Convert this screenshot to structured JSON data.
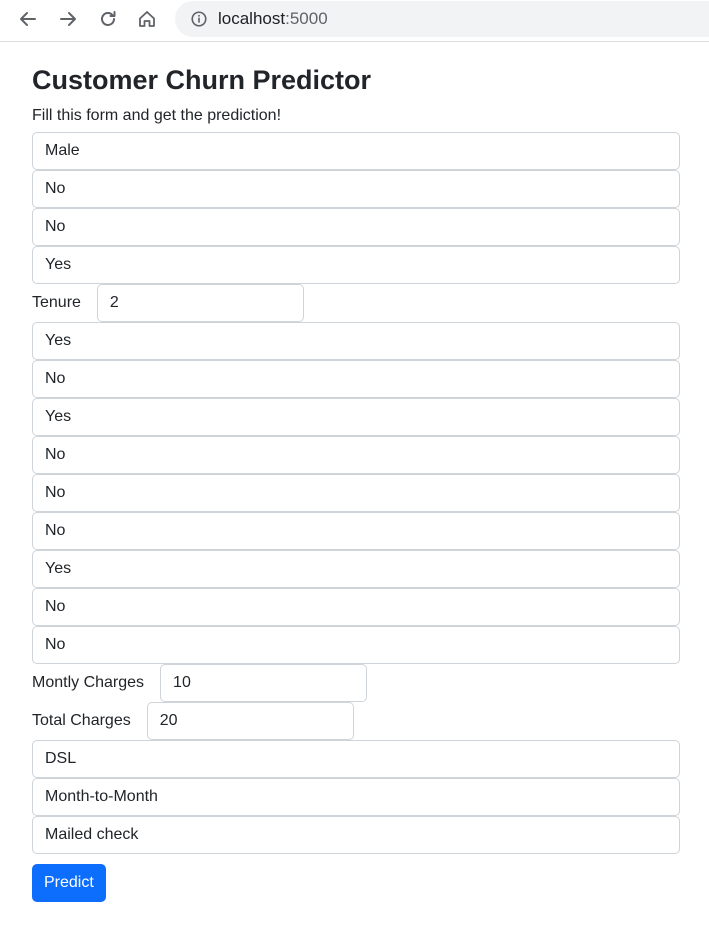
{
  "browser": {
    "url_host": "localhost",
    "url_port": ":5000"
  },
  "page": {
    "title": "Customer Churn Predictor",
    "subtitle": "Fill this form and get the prediction!"
  },
  "form": {
    "gender": "Male",
    "senior_citizen": "No",
    "partner": "No",
    "dependents": "Yes",
    "tenure_label": "Tenure",
    "tenure_value": "2",
    "phone_service": "Yes",
    "multiple_lines": "No",
    "online_security": "Yes",
    "online_backup": "No",
    "device_protection": "No",
    "tech_support": "No",
    "streaming_tv": "Yes",
    "streaming_movies": "No",
    "paperless_billing": "No",
    "monthly_charges_label": "Montly Charges",
    "monthly_charges_value": "10",
    "total_charges_label": "Total Charges",
    "total_charges_value": "20",
    "internet_service": "DSL",
    "contract": "Month-to-Month",
    "payment_method": "Mailed check",
    "submit_label": "Predict"
  }
}
